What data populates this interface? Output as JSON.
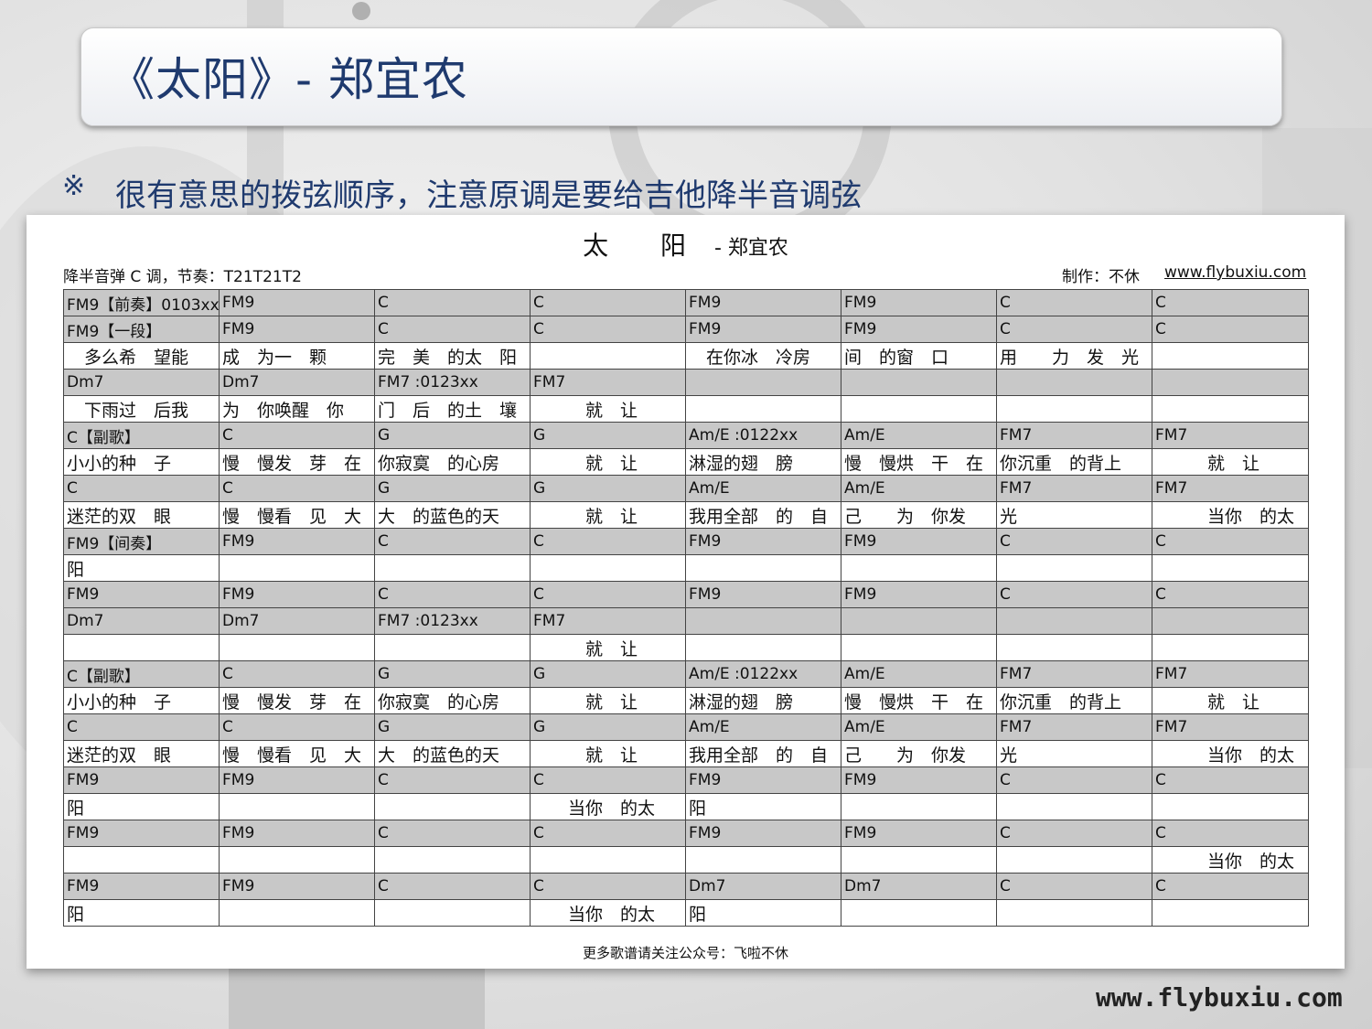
{
  "header": {
    "title": "《太阳》- 郑宜农",
    "subtitle_mark": "※",
    "subtitle": "很有意思的拨弦顺序，注意原调是要给吉他降半音调弦"
  },
  "sheet": {
    "title_main": "太 阳",
    "title_artist": " - 郑宜农",
    "key_info": "降半音弹 C 调，节奏：T21T21T2",
    "maker": "制作：不休",
    "site": "www.flybuxiu.com",
    "footer": "更多歌谱请关注公众号：飞啦不休"
  },
  "rows": [
    {
      "type": "c",
      "cells": [
        "FM9【前奏】0103xx",
        "FM9",
        "C",
        "C",
        "FM9",
        "FM9",
        "C",
        "C"
      ]
    },
    {
      "type": "c",
      "cells": [
        "FM9【一段】",
        "FM9",
        "C",
        "C",
        "FM9",
        "FM9",
        "C",
        "C"
      ]
    },
    {
      "type": "l",
      "cells": [
        "　多么希　望能",
        "成　为一　颗",
        "完　美　的太　阳",
        "",
        "　在你冰　冷房",
        "间　的窗　口",
        "用　　力　发　光",
        ""
      ]
    },
    {
      "type": "c",
      "cells": [
        "Dm7",
        "Dm7",
        "FM7 :0123xx",
        "FM7",
        "",
        "",
        "",
        ""
      ]
    },
    {
      "type": "l",
      "cells": [
        "　下雨过　后我",
        "为　你唤醒　你",
        "门　后　的土　壤",
        "　　　就　让",
        "",
        "",
        "",
        ""
      ]
    },
    {
      "type": "c",
      "cells": [
        "C【副歌】",
        "C",
        "G",
        "G",
        "Am/E :0122xx",
        "Am/E",
        "FM7",
        "FM7"
      ]
    },
    {
      "type": "l",
      "cells": [
        "小小的种　子",
        "慢　慢发　芽　在",
        "你寂寞　的心房",
        "　　　就　让",
        "淋湿的翅　膀",
        "慢　慢烘　干　在",
        "你沉重　的背上",
        "　　　就　让"
      ]
    },
    {
      "type": "c",
      "cells": [
        "C",
        "C",
        "G",
        "G",
        "Am/E",
        "Am/E",
        "FM7",
        "FM7"
      ]
    },
    {
      "type": "l",
      "cells": [
        "迷茫的双　眼",
        "慢　慢看　见　大",
        "大　的蓝色的天",
        "　　　就　让",
        "我用全部　的　自",
        "己　　为　你发",
        "光",
        "　　　当你　的太"
      ]
    },
    {
      "type": "c",
      "cells": [
        "FM9【间奏】",
        "FM9",
        "C",
        "C",
        "FM9",
        "FM9",
        "C",
        "C"
      ]
    },
    {
      "type": "l",
      "cells": [
        "阳",
        "",
        "",
        "",
        "",
        "",
        "",
        ""
      ]
    },
    {
      "type": "c",
      "cells": [
        "FM9",
        "FM9",
        "C",
        "C",
        "FM9",
        "FM9",
        "C",
        "C"
      ]
    },
    {
      "type": "c",
      "cells": [
        "Dm7",
        "Dm7",
        "FM7 :0123xx",
        "FM7",
        "",
        "",
        "",
        ""
      ]
    },
    {
      "type": "l",
      "cells": [
        "",
        "",
        "",
        "　　　就　让",
        "",
        "",
        "",
        ""
      ]
    },
    {
      "type": "c",
      "cells": [
        "C【副歌】",
        "C",
        "G",
        "G",
        "Am/E :0122xx",
        "Am/E",
        "FM7",
        "FM7"
      ]
    },
    {
      "type": "l",
      "cells": [
        "小小的种　子",
        "慢　慢发　芽　在",
        "你寂寞　的心房",
        "　　　就　让",
        "淋湿的翅　膀",
        "慢　慢烘　干　在",
        "你沉重　的背上",
        "　　　就　让"
      ]
    },
    {
      "type": "c",
      "cells": [
        "C",
        "C",
        "G",
        "G",
        "Am/E",
        "Am/E",
        "FM7",
        "FM7"
      ]
    },
    {
      "type": "l",
      "cells": [
        "迷茫的双　眼",
        "慢　慢看　见　大",
        "大　的蓝色的天",
        "　　　就　让",
        "我用全部　的　自",
        "己　　为　你发",
        "光",
        "　　　当你　的太"
      ]
    },
    {
      "type": "c",
      "cells": [
        "FM9",
        "FM9",
        "C",
        "C",
        "FM9",
        "FM9",
        "C",
        "C"
      ]
    },
    {
      "type": "l",
      "cells": [
        "阳",
        "",
        "",
        "　　当你　的太",
        "阳",
        "",
        "",
        ""
      ]
    },
    {
      "type": "c",
      "cells": [
        "FM9",
        "FM9",
        "C",
        "C",
        "FM9",
        "FM9",
        "C",
        "C"
      ]
    },
    {
      "type": "l",
      "cells": [
        "",
        "",
        "",
        "",
        "",
        "",
        "",
        "　　　当你　的太"
      ]
    },
    {
      "type": "c",
      "cells": [
        "FM9",
        "FM9",
        "C",
        "C",
        "Dm7",
        "Dm7",
        "C",
        "C"
      ]
    },
    {
      "type": "l",
      "cells": [
        "阳",
        "",
        "",
        "　　当你　的太",
        "阳",
        "",
        "",
        ""
      ]
    }
  ],
  "watermark": "www.flybuxiu.com"
}
